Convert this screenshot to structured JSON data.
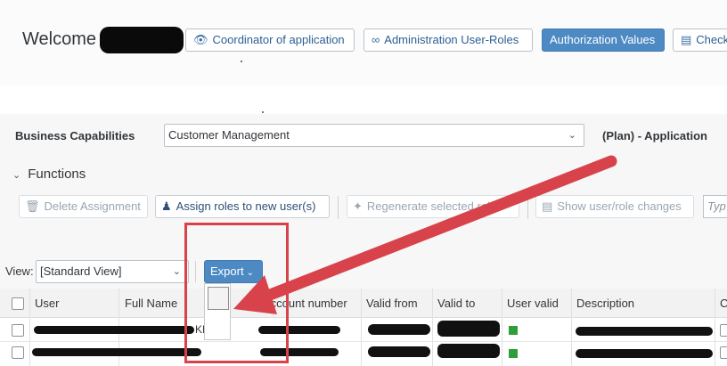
{
  "header": {
    "welcome_text": "Welcome",
    "buttons": [
      {
        "label": "Coordinator of application",
        "icon": "eye-icon",
        "style": "default"
      },
      {
        "label": "Administration User-Roles",
        "icon": "glasses-icon",
        "style": "default"
      },
      {
        "label": "Authorization Values",
        "style": "primary"
      },
      {
        "label": "Check",
        "icon": "document-icon",
        "style": "default"
      }
    ]
  },
  "filters": {
    "business_capabilities_label": "Business Capabilities",
    "business_capabilities_value": "Customer Management",
    "plan_label": "(Plan) - Application"
  },
  "functions": {
    "title": "Functions",
    "toolbar": {
      "delete_assignment": "Delete Assignment",
      "assign_roles": "Assign roles to new user(s)",
      "regenerate": "Regenerate selected roles",
      "show_changes": "Show user/role changes",
      "type_placeholder": "Typ"
    }
  },
  "view": {
    "label": "View:",
    "value": "[Standard View]",
    "export_label": "Export"
  },
  "table": {
    "columns": [
      "User",
      "Full Name",
      "Account number",
      "Valid from",
      "Valid to",
      "User valid",
      "Description",
      "C"
    ],
    "row_text_fragment": "KH"
  },
  "colors": {
    "primary": "#4d8ac4",
    "link": "#2c5f94",
    "status_valid": "#2e9e3a",
    "annotation": "#d8434b"
  }
}
